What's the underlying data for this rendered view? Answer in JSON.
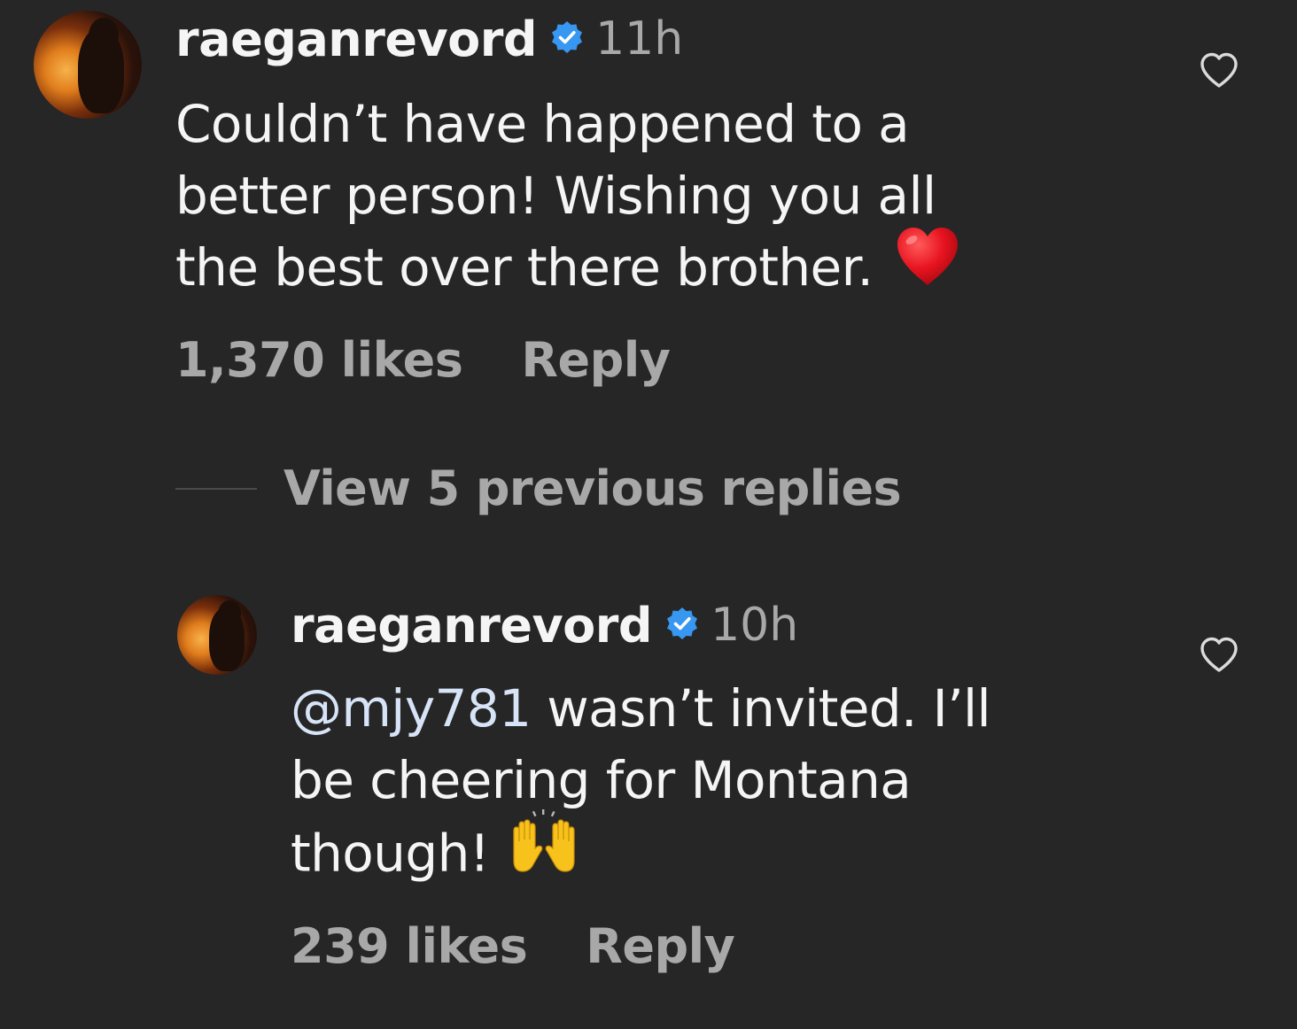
{
  "comments": [
    {
      "username": "raeganrevord",
      "time": "11h",
      "body_lines": [
        "Couldn’t have happened to a",
        "better person! Wishing you all",
        "the best over there brother."
      ],
      "trailing_emoji": "red-heart",
      "likes": "1,370 likes",
      "reply_label": "Reply"
    },
    {
      "username": "raeganrevord",
      "time": "10h",
      "mention": "@mjy781",
      "body_line1_rest": " wasn’t invited. I’ll",
      "body_lines": [
        "be cheering for Montana",
        "though!"
      ],
      "trailing_emoji": "raising-hands",
      "likes": "239 likes",
      "reply_label": "Reply"
    }
  ],
  "view_replies_label": "View 5 previous replies",
  "colors": {
    "background": "#262626",
    "text": "#f5f5f5",
    "secondary": "#a8a8a8",
    "verified": "#3897f0",
    "mention": "#d7e4f7"
  },
  "icons": [
    "verified-badge-icon",
    "heart-outline-icon",
    "red-heart-emoji",
    "raising-hands-emoji"
  ]
}
